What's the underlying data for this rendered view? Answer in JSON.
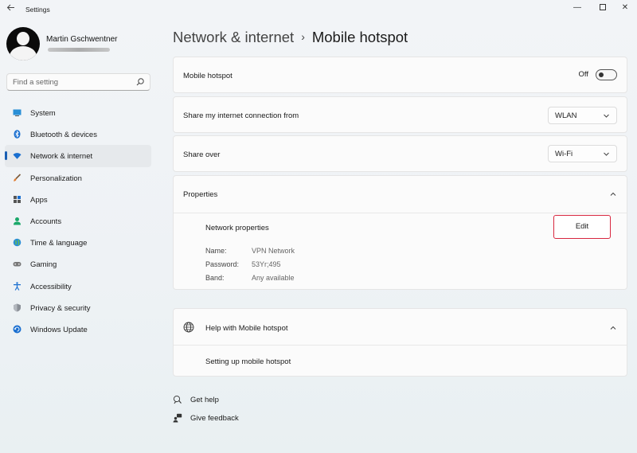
{
  "window": {
    "title": "Settings",
    "controls": {
      "minimize": "—",
      "close": "✕"
    }
  },
  "user": {
    "name": "Martin Gschwentner"
  },
  "search": {
    "placeholder": "Find a setting"
  },
  "sidebar": {
    "items": [
      {
        "label": "System",
        "icon": "system-icon"
      },
      {
        "label": "Bluetooth & devices",
        "icon": "bluetooth-icon"
      },
      {
        "label": "Network & internet",
        "icon": "wifi-icon",
        "active": true
      },
      {
        "label": "Personalization",
        "icon": "brush-icon"
      },
      {
        "label": "Apps",
        "icon": "apps-icon"
      },
      {
        "label": "Accounts",
        "icon": "accounts-icon"
      },
      {
        "label": "Time & language",
        "icon": "globe-icon"
      },
      {
        "label": "Gaming",
        "icon": "gamepad-icon"
      },
      {
        "label": "Accessibility",
        "icon": "accessibility-icon"
      },
      {
        "label": "Privacy & security",
        "icon": "shield-icon"
      },
      {
        "label": "Windows Update",
        "icon": "update-icon"
      }
    ]
  },
  "breadcrumb": {
    "parent": "Network & internet",
    "separator": "›",
    "current": "Mobile hotspot"
  },
  "hotspot": {
    "label": "Mobile hotspot",
    "state": "Off"
  },
  "share_from": {
    "label": "Share my internet connection from",
    "value": "WLAN"
  },
  "share_over": {
    "label": "Share over",
    "value": "Wi-Fi"
  },
  "properties": {
    "title": "Properties",
    "network_properties": "Network properties",
    "edit_label": "Edit",
    "fields": [
      {
        "key": "Name:",
        "value": "VPN Network"
      },
      {
        "key": "Password:",
        "value": "53Yr;495"
      },
      {
        "key": "Band:",
        "value": "Any available"
      }
    ]
  },
  "help": {
    "title": "Help with Mobile hotspot",
    "link": "Setting up mobile hotspot"
  },
  "footer": {
    "get_help": "Get help",
    "give_feedback": "Give feedback"
  },
  "colors": {
    "accent": "#1a5fb4",
    "highlight_border": "#d8273f"
  }
}
